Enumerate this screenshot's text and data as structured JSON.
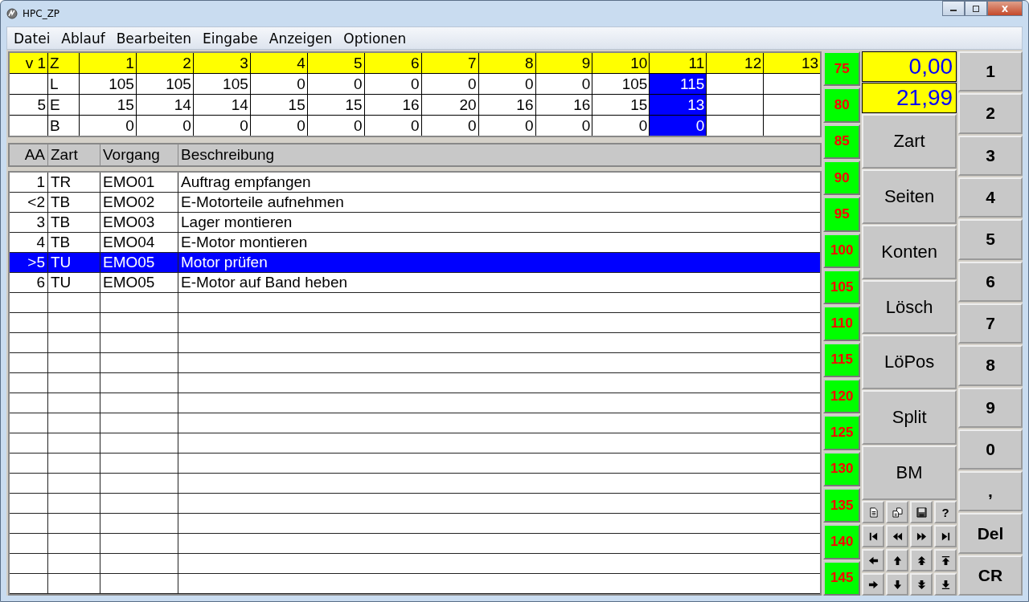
{
  "window": {
    "title": "HPC_ZP"
  },
  "menu": [
    "Datei",
    "Ablauf",
    "Bearbeiten",
    "Eingabe",
    "Anzeigen",
    "Optionen"
  ],
  "grid": {
    "corner": "v 1",
    "row_label_header": "Z",
    "columns": [
      "1",
      "2",
      "3",
      "4",
      "5",
      "6",
      "7",
      "8",
      "9",
      "10",
      "11",
      "12",
      "13"
    ],
    "rows": [
      {
        "label": "L",
        "cells": [
          {
            "value": "105",
            "selected": false
          },
          {
            "value": "105",
            "selected": false
          },
          {
            "value": "105",
            "selected": false
          },
          {
            "value": "0",
            "selected": false
          },
          {
            "value": "0",
            "selected": false
          },
          {
            "value": "0",
            "selected": false
          },
          {
            "value": "0",
            "selected": false
          },
          {
            "value": "0",
            "selected": false
          },
          {
            "value": "0",
            "selected": false
          },
          {
            "value": "105",
            "selected": false
          },
          {
            "value": "115",
            "selected": true
          }
        ]
      },
      {
        "marker": "5",
        "label": "E",
        "cells": [
          {
            "value": "15",
            "selected": false
          },
          {
            "value": "14",
            "selected": false
          },
          {
            "value": "14",
            "selected": false
          },
          {
            "value": "15",
            "selected": false
          },
          {
            "value": "15",
            "selected": false
          },
          {
            "value": "16",
            "selected": false
          },
          {
            "value": "20",
            "selected": false
          },
          {
            "value": "16",
            "selected": false
          },
          {
            "value": "16",
            "selected": false
          },
          {
            "value": "15",
            "selected": false
          },
          {
            "value": "13",
            "selected": true
          }
        ]
      },
      {
        "label": "B",
        "cells": [
          {
            "value": "0",
            "selected": false
          },
          {
            "value": "0",
            "selected": false
          },
          {
            "value": "0",
            "selected": false
          },
          {
            "value": "0",
            "selected": false
          },
          {
            "value": "0",
            "selected": false
          },
          {
            "value": "0",
            "selected": false
          },
          {
            "value": "0",
            "selected": false
          },
          {
            "value": "0",
            "selected": false
          },
          {
            "value": "0",
            "selected": false
          },
          {
            "value": "0",
            "selected": false
          },
          {
            "value": "0",
            "selected": true
          }
        ]
      }
    ]
  },
  "list": {
    "columns": [
      "AA",
      "Zart",
      "Vorgang",
      "Beschreibung"
    ],
    "rows": [
      {
        "aa": "1",
        "zart": "TR",
        "vorgang": "EMO01",
        "beschreibung": "Auftrag empfangen",
        "selected": false
      },
      {
        "aa": "<2",
        "zart": "TB",
        "vorgang": "EMO02",
        "beschreibung": "E-Motorteile aufnehmen",
        "selected": false
      },
      {
        "aa": "3",
        "zart": "TB",
        "vorgang": "EMO03",
        "beschreibung": "Lager montieren",
        "selected": false
      },
      {
        "aa": "4",
        "zart": "TB",
        "vorgang": "EMO04",
        "beschreibung": "E-Motor montieren",
        "selected": false
      },
      {
        "aa": ">5",
        "zart": "TU",
        "vorgang": "EMO05",
        "beschreibung": "Motor prüfen",
        "selected": true
      },
      {
        "aa": "6",
        "zart": "TU",
        "vorgang": "EMO05",
        "beschreibung": "E-Motor auf Band heben",
        "selected": false
      }
    ]
  },
  "level_buttons": [
    "75",
    "80",
    "85",
    "90",
    "95",
    "100",
    "105",
    "110",
    "115",
    "120",
    "125",
    "130",
    "135",
    "140",
    "145"
  ],
  "displays": [
    "0,00",
    "21,99"
  ],
  "function_buttons": [
    "Zart",
    "Seiten",
    "Konten",
    "Lösch",
    "LöPos",
    "Split",
    "BM"
  ],
  "tool_buttons": [
    {
      "kind": "document"
    },
    {
      "kind": "copy"
    },
    {
      "kind": "save"
    },
    {
      "kind": "text",
      "label": "?"
    },
    {
      "kind": "first"
    },
    {
      "kind": "prev"
    },
    {
      "kind": "next"
    },
    {
      "kind": "last"
    },
    {
      "kind": "left"
    },
    {
      "kind": "up"
    },
    {
      "kind": "page-up"
    },
    {
      "kind": "top"
    },
    {
      "kind": "right"
    },
    {
      "kind": "down"
    },
    {
      "kind": "page-down"
    },
    {
      "kind": "bottom"
    }
  ],
  "keypad": [
    "1",
    "2",
    "3",
    "4",
    "5",
    "6",
    "7",
    "8",
    "9",
    "0",
    ",",
    "Del",
    "CR"
  ]
}
